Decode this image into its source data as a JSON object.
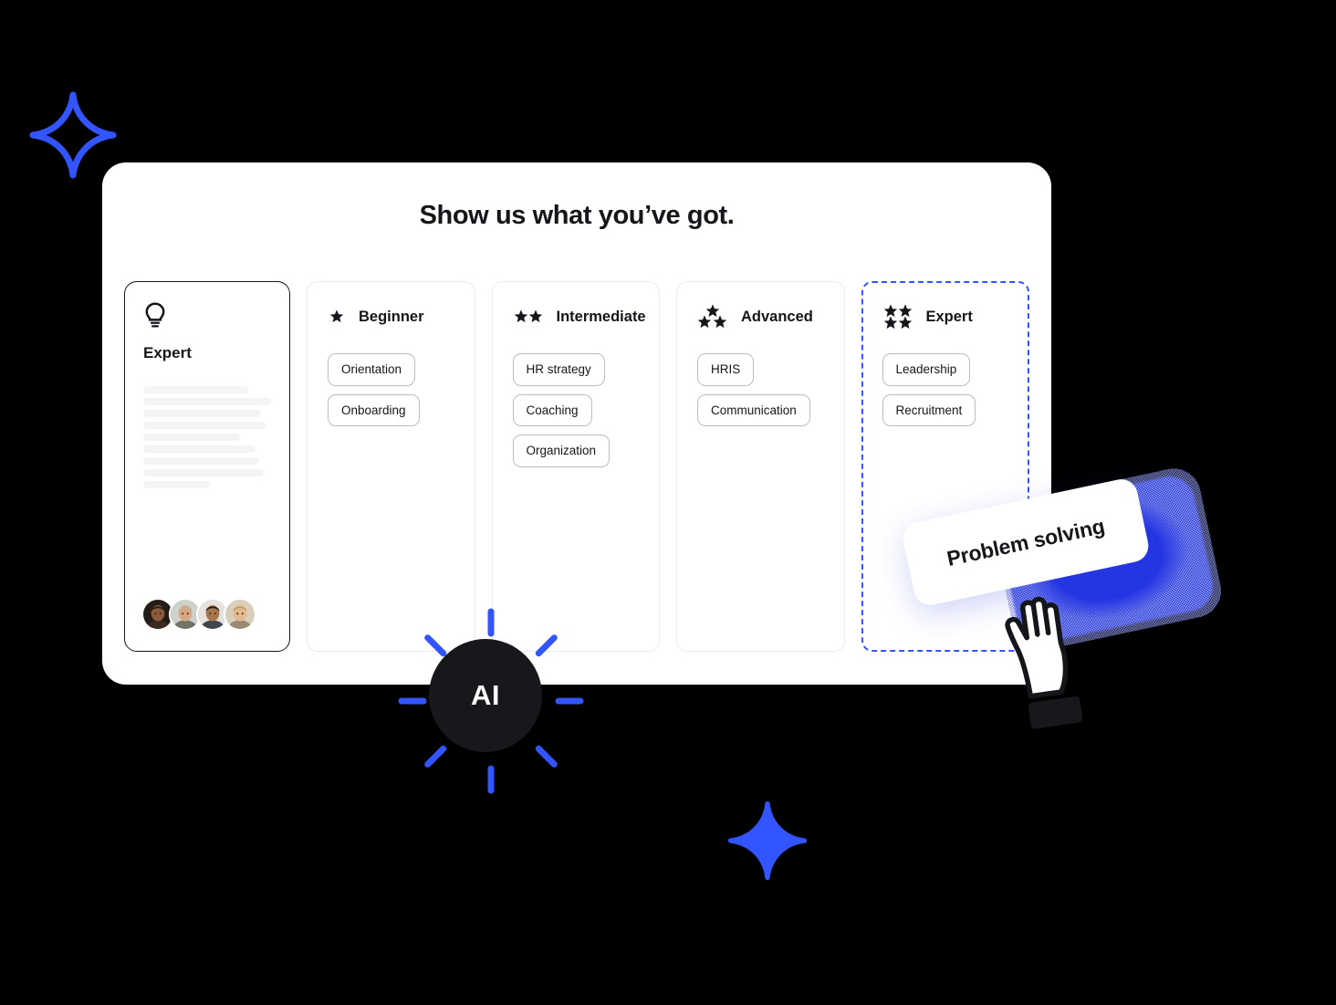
{
  "page": {
    "title": "Show us what you’ve got.",
    "accent_blue": "#3355FF",
    "dark": "#14161A",
    "background": "#000000"
  },
  "profile_card": {
    "icon": "lightbulb-icon",
    "title": "Expert",
    "skeleton_widths": [
      "82%",
      "100%",
      "92%",
      "96%",
      "76%",
      "88%",
      "90%",
      "94%",
      "52%"
    ],
    "avatar_count": 4
  },
  "levels": [
    {
      "name": "Beginner",
      "star_count": 1,
      "star_layout": "single",
      "selected": false,
      "skills": [
        "Orientation",
        "Onboarding"
      ]
    },
    {
      "name": "Intermediate",
      "star_count": 2,
      "star_layout": "row",
      "selected": false,
      "skills": [
        "HR strategy",
        "Coaching",
        "Organization"
      ]
    },
    {
      "name": "Advanced",
      "star_count": 3,
      "star_layout": "triangle",
      "selected": false,
      "skills": [
        "HRIS",
        "Communication"
      ]
    },
    {
      "name": "Expert",
      "star_count": 4,
      "star_layout": "grid",
      "selected": true,
      "skills": [
        "Leadership",
        "Recruitment"
      ]
    }
  ],
  "floating_tag": {
    "label": "Problem solving",
    "glow_color": "#2538E8",
    "cursor": "hand-pointer-cursor"
  },
  "ai_badge": {
    "label": "AI",
    "ray_count": 8,
    "ray_color": "#3355FF",
    "circle_color": "#17181C"
  },
  "decorations": {
    "sparkle_top": "sparkle-icon",
    "sparkle_bottom": "sparkle-icon"
  }
}
